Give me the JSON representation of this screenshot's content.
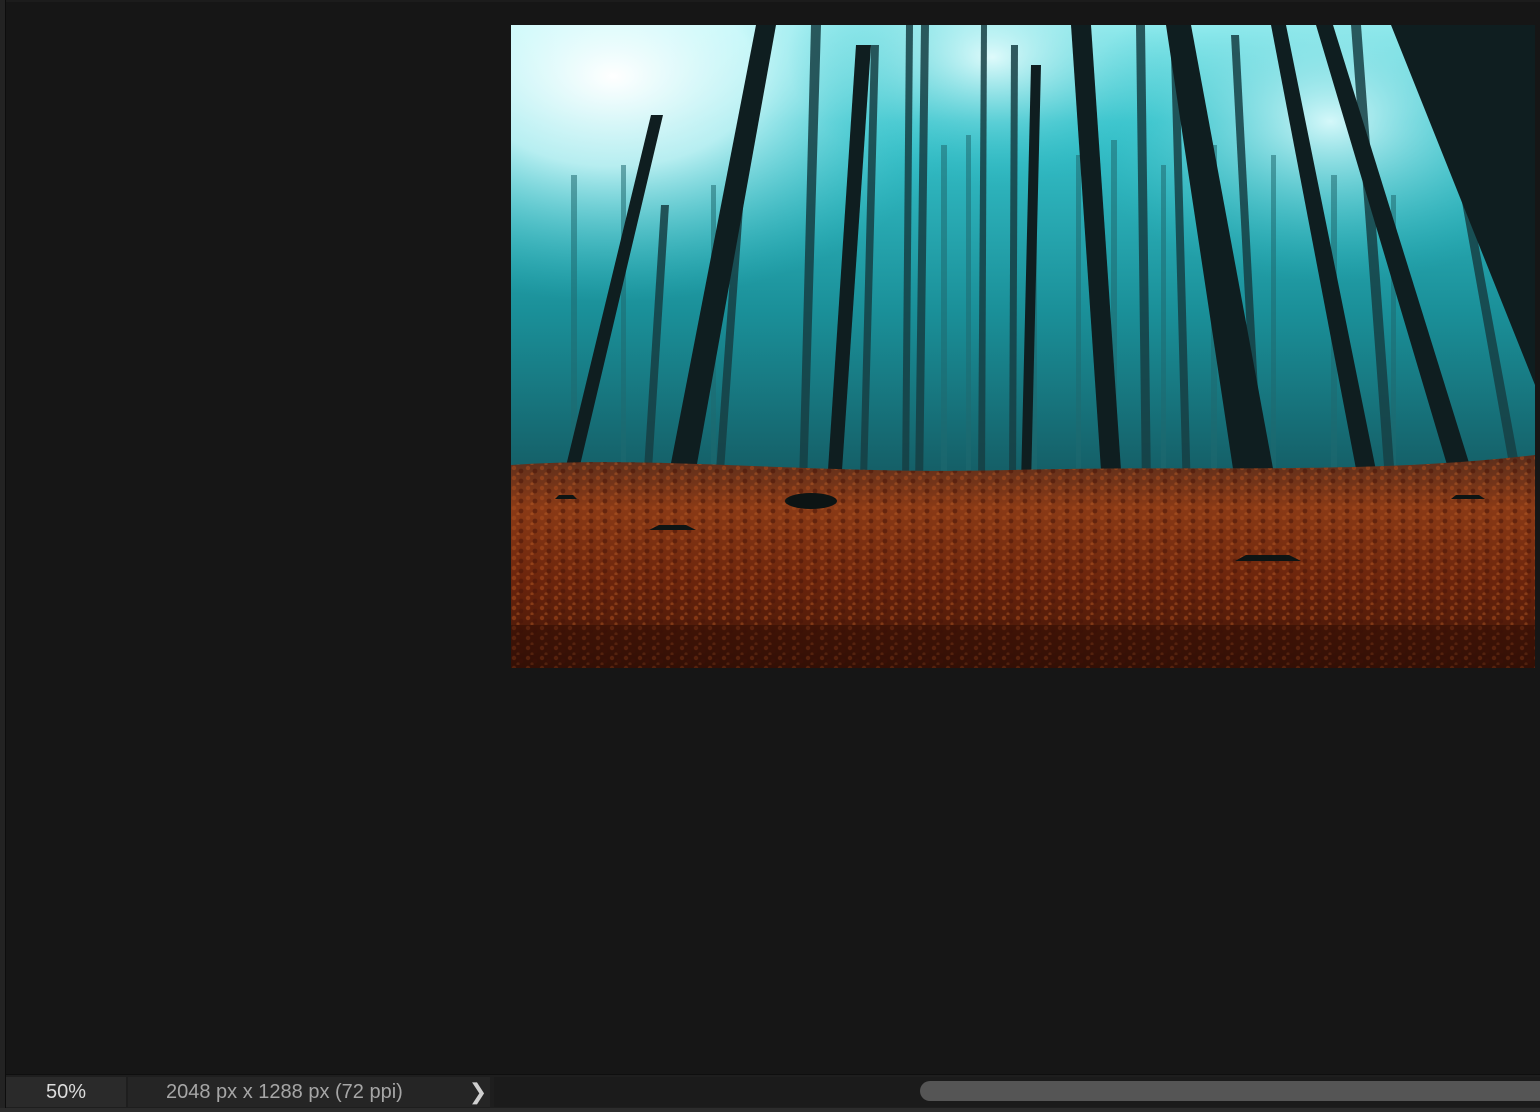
{
  "status_bar": {
    "zoom": "50%",
    "document_info": "2048 px x 1288 px (72 ppi)",
    "chevron": "❯"
  },
  "scrollbar": {
    "horizontal_position": 0.41
  },
  "colors": {
    "workspace": "#161616",
    "fog": "#1bb8c4",
    "foreground_red": "#7a2810"
  }
}
